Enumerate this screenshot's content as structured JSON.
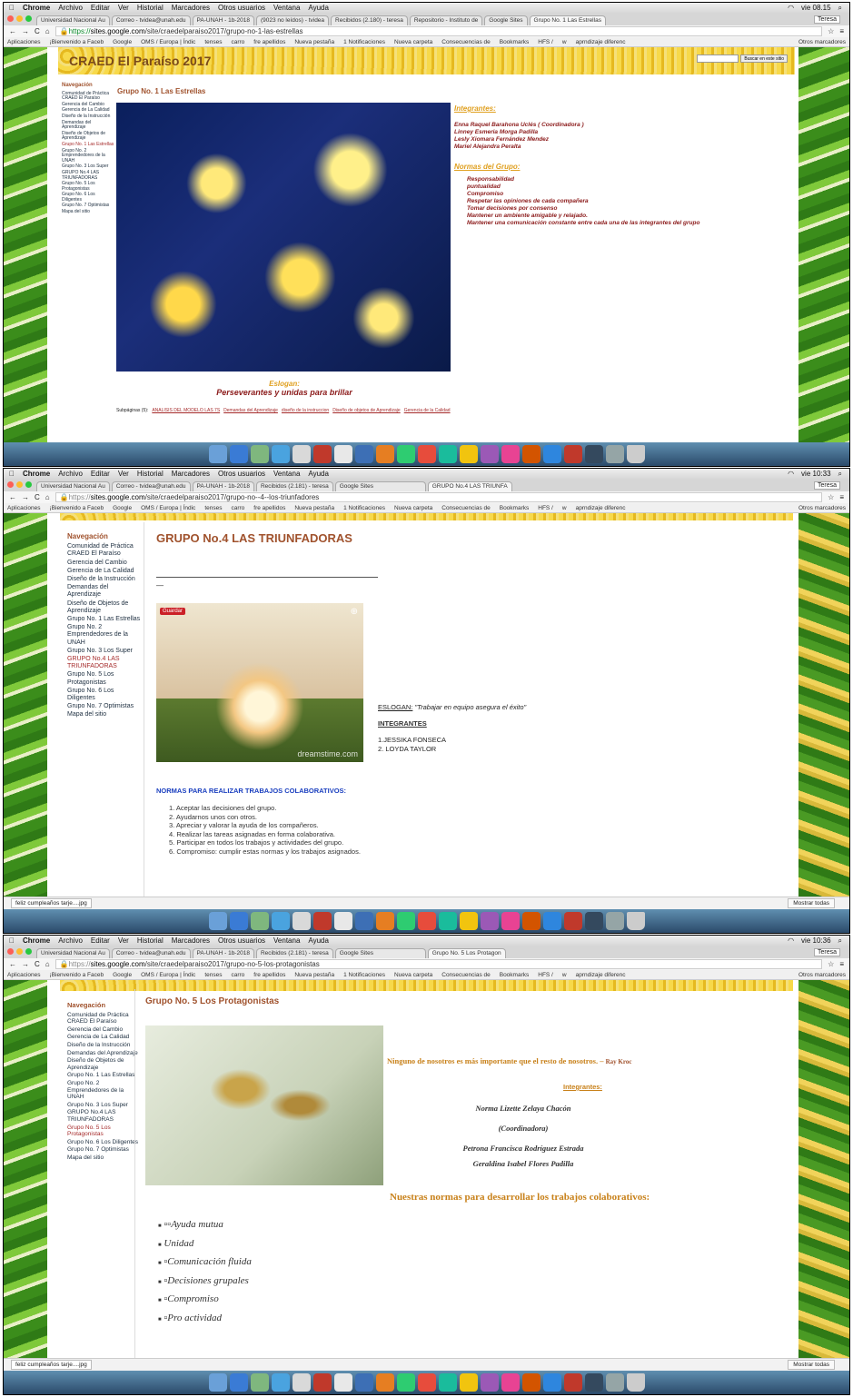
{
  "screens": [
    {
      "menu": {
        "app": "Chrome",
        "items": [
          "Archivo",
          "Editar",
          "Ver",
          "Historial",
          "Marcadores",
          "Otros usuarios",
          "Ventana",
          "Ayuda"
        ],
        "clock": "vie 08.15"
      },
      "tabs": [
        "Universidad Nacional Au",
        "Correo - tvidea@unah.edu",
        "PA-UNAH - 1b-2018",
        "(9023 no leídos) - tvidea",
        "Recibidos (2.180) - teresa",
        "Repositorio - Instituto de",
        "Google Sites",
        "Grupo No. 1 Las Estrellas"
      ],
      "user": "Teresa",
      "url_prefix": "https://",
      "url_host": "sites.google.com",
      "url_path": "/site/craedelparaiso2017/grupo-no-1-las-estrellas",
      "site_title": "CRAED El Paraíso 2017",
      "search_button": "Buscar en este sitio",
      "page_title": "Grupo No. 1 Las Estrellas",
      "integrantes_title": "Integrantes:",
      "integrantes": [
        "Enna Raquel Barahona Uclés ( Coordinadora )",
        "Linney Esmeria Morga Padilla",
        "Lesly Xiomara Fernández Mendez",
        "Mariel Alejandra Peralta"
      ],
      "normas_title": "Normas del Grupo:",
      "normas": [
        "Responsabilidad",
        "puntualidad",
        "Compromiso",
        "Respetar las opiniones de cada compañera",
        "Tomar decisiones por consenso",
        "Mantener un ambiente amigable y relajado.",
        "Mantener una comunicación constante entre cada una de las integrantes del grupo"
      ],
      "eslogan_title": "Eslogan:",
      "eslogan": "Perseverantes y unidas para brillar",
      "subpages_label": "Subpáginas (5):",
      "subpages": [
        "ANALISIS DEL MODELO LAS 7S",
        "Demandas del Aprendizaje",
        "diseño de la instruccion",
        "Diseño de objetos de Aprendizaje",
        "Gerencia de la Calidad"
      ]
    },
    {
      "menu": {
        "app": "Chrome",
        "items": [
          "Archivo",
          "Editar",
          "Ver",
          "Historial",
          "Marcadores",
          "Otros usuarios",
          "Ventana",
          "Ayuda"
        ],
        "clock": "vie 10:33"
      },
      "tabs": [
        "Universidad Nacional Au",
        "Correo - tvidea@unah.edu",
        "PA-UNAH - 1b-2018",
        "Recibidos (2.181) - teresa",
        "Google Sites",
        "GRUPO No.4 LAS TRIUNFA"
      ],
      "user": "Teresa",
      "url_prefix": "https://",
      "url_host": "sites.google.com",
      "url_path": "/site/craedelparaiso2017/grupo-no--4--los-triunfadores",
      "page_title": "GRUPO No.4 LAS TRIUNFADORAS",
      "dash": "—",
      "save_badge": "Guardar",
      "watermark": "dreamstime.com",
      "eslogan_label": "ESLOGAN:",
      "eslogan": "\"Trabajar en equipo asegura el éxito\"",
      "integrantes_title": "INTEGRANTES",
      "integrantes": [
        "1.JESSIKA FONSECA",
        "2. LOYDA TAYLOR"
      ],
      "normas_title": "NORMAS PARA REALIZAR TRABAJOS COLABORATIVOS:",
      "normas": [
        "1. Aceptar las decisiones  del grupo.",
        "2. Ayudarnos unos con otros.",
        "3. Apreciar y valorar la ayuda de los compañeros.",
        "4. Realizar las tareas asignadas en forma colaborativa.",
        "5. Participar en todos los trabajos y actividades del grupo.",
        "6. Compromiso: cumplir estas normas y los trabajos asignados."
      ],
      "download_file": "feliz cumpleaños tarje....jpg",
      "download_show": "Mostrar todas"
    },
    {
      "menu": {
        "app": "Chrome",
        "items": [
          "Archivo",
          "Editar",
          "Ver",
          "Historial",
          "Marcadores",
          "Otros usuarios",
          "Ventana",
          "Ayuda"
        ],
        "clock": "vie 10:36"
      },
      "tabs": [
        "Universidad Nacional Au",
        "Correo - tvidea@unah.edu",
        "PA-UNAH - 1b-2018",
        "Recibidos (2.181) - teresa",
        "Google Sites",
        "Grupo No. 5 Los Protagon"
      ],
      "user": "Teresa",
      "url_prefix": "https://",
      "url_host": "sites.google.com",
      "url_path": "/site/craedelparaiso2017/grupo-no-5-los-protagonistas",
      "page_title": "Grupo No. 5 Los Protagonistas",
      "quote": "Ninguno de nosotros es más importante que el resto de nosotros. –",
      "quote_author": "Ray Kroc",
      "integrantes_title": "Integrantes:",
      "integrantes": [
        "Norma Lizette Zelaya Chacón",
        "(Coordinadora)",
        "Petrona Francisca Rodríguez Estrada",
        "Geraldina Isabel Flores Padilla"
      ],
      "normas_title": "Nuestras normas para desarrollar los trabajos colaborativos:",
      "normas": [
        "Ayuda mutua",
        "Unidad",
        "Comunicación fluida",
        "Decisiones grupales",
        "Compromiso",
        "Pro actividad"
      ],
      "download_file": "feliz cumpleaños tarje....jpg",
      "download_show": "Mostrar todas"
    }
  ],
  "bookmarks": [
    "Aplicaciones",
    "¡Bienvenido a Faceb",
    "Google",
    "OMS / Europa | Índic",
    "tenses",
    "carro",
    "fre apellidos",
    "Nueva pestaña",
    "1 Notificaciones",
    "Nueva carpeta",
    "Consecuencias de",
    "Bookmarks",
    "HFS /",
    "w",
    "aprndizaje diferenc",
    "Otros marcadores"
  ],
  "nav": {
    "title": "Navegación",
    "items": [
      "Comunidad de Práctica CRAED El Paraíso",
      "Gerencia del Cambio",
      "Gerencia de La Calidad",
      "Diseño de la Instrucción",
      "Demandas del Aprendizaje",
      "Diseño de Objetos de Aprendizaje",
      "Grupo No. 1 Las Estrellas",
      "Grupo No. 2 Emprendedores de la UNAH",
      "Grupo No. 3 Los Super",
      "GRUPO No.4 LAS TRIUNFADORAS",
      "Grupo No. 5 Los Protagonistas",
      "Grupo No. 6 Los Diligentes",
      "Grupo No. 7 Optimistas",
      "Mapa del sitio"
    ]
  },
  "colors": {
    "accent": "#a0522d",
    "blue_heading": "#1a3fbf",
    "red_text": "#8b1a1a",
    "gold_heading": "#e0a020",
    "quote_gold": "#c8811a"
  }
}
